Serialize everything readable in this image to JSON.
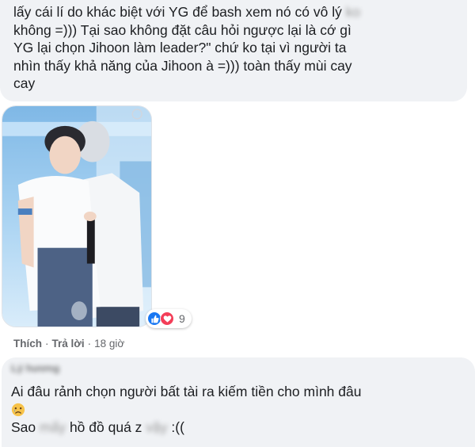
{
  "comment1": {
    "line1": "lấy cái lí do khác biệt với YG để bash xem nó có vô lý",
    "line1_hidden": "ko",
    "lines_rest": "không =))) Tại sao không đặt câu hỏi ngược lại là cớ gì\nYG lại chọn Jihoon làm leader?\" chứ ko tại vì người ta\nnhìn thấy khả năng của Jihoon à =))) toàn thấy mùi cay\ncay",
    "photo_alt": "photo-attachment",
    "reactions": {
      "like_icon": "thumbs-up-icon",
      "love_icon": "heart-icon",
      "count": "9"
    },
    "actions": {
      "like": "Thích",
      "dot": "·",
      "reply": "Trả lời",
      "time_sep": "·",
      "time": "18 giờ"
    }
  },
  "comment2": {
    "author": "Lý hương",
    "line1": "Ai đâu rảnh chọn người bất tài ra kiếm tiền cho mình đâu",
    "emoji": "sad-face-icon",
    "line2_start": "Sao",
    "line2_hidden1": "mấy",
    "line2_mid": "hồ đồ quá z",
    "line2_hidden2": "vậy",
    "line2_end": ":(("
  },
  "colors": {
    "bubble": "#f0f2f5",
    "like": "#1877f2",
    "love": "#f33e58",
    "meta": "#65676b"
  }
}
